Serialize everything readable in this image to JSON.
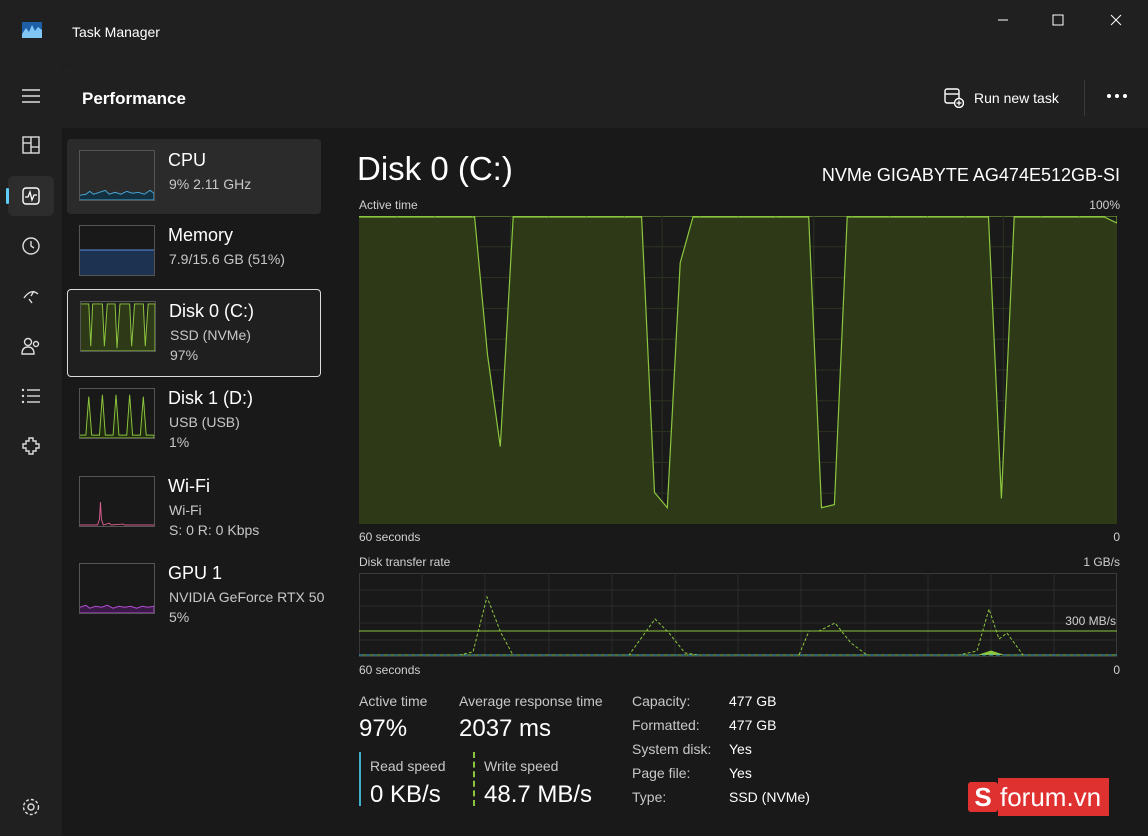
{
  "app": {
    "title": "Task Manager"
  },
  "header": {
    "title": "Performance",
    "run_task_label": "Run new task"
  },
  "nav": {
    "items": [
      "menu-icon",
      "processes-icon",
      "performance-icon",
      "app-history-icon",
      "startup-icon",
      "users-icon",
      "details-icon",
      "services-icon"
    ]
  },
  "sidebar": {
    "items": [
      {
        "name": "CPU",
        "line1": "9%  2.11 GHz",
        "line2": ""
      },
      {
        "name": "Memory",
        "line1": "7.9/15.6 GB (51%)",
        "line2": ""
      },
      {
        "name": "Disk 0 (C:)",
        "line1": "SSD (NVMe)",
        "line2": "97%"
      },
      {
        "name": "Disk 1 (D:)",
        "line1": "USB (USB)",
        "line2": "1%"
      },
      {
        "name": "Wi-Fi",
        "line1": "Wi-Fi",
        "line2": "S: 0 R: 0 Kbps"
      },
      {
        "name": "GPU 1",
        "line1": "NVIDIA GeForce RTX 50",
        "line2": "5%"
      }
    ]
  },
  "panel": {
    "title": "Disk 0 (C:)",
    "model": "NVMe GIGABYTE AG474E512GB-SI",
    "active_time_graph": {
      "label": "Active time",
      "max_label": "100%",
      "time_label": "60 seconds",
      "min_label": "0"
    },
    "transfer_graph": {
      "label": "Disk transfer rate",
      "max_label": "1 GB/s",
      "mid_label": "300 MB/s",
      "time_label": "60 seconds",
      "min_label": "0"
    }
  },
  "stats": {
    "active_time": {
      "label": "Active time",
      "value": "97%"
    },
    "avg_response": {
      "label": "Average response time",
      "value": "2037 ms"
    },
    "read_speed": {
      "label": "Read speed",
      "value": "0 KB/s"
    },
    "write_speed": {
      "label": "Write speed",
      "value": "48.7 MB/s"
    }
  },
  "info": [
    {
      "label": "Capacity:",
      "value": "477 GB"
    },
    {
      "label": "Formatted:",
      "value": "477 GB"
    },
    {
      "label": "System disk:",
      "value": "Yes"
    },
    {
      "label": "Page file:",
      "value": "Yes"
    },
    {
      "label": "Type:",
      "value": "SSD (NVMe)"
    }
  ],
  "watermark": {
    "letter": "S",
    "text": "forum.vn"
  },
  "colors": {
    "disk": "#8cc63e",
    "disk_fill": "#2e3a17",
    "cpu": "#4aa8d8",
    "memory": "#5b8fd8",
    "wifi": "#d85c8c",
    "gpu": "#b24fd0",
    "read": "#3fb0c8",
    "write": "#8cc63e"
  },
  "chart_data": {
    "type": "area",
    "title": "Active time",
    "x_label": "60 seconds",
    "ylim": [
      0,
      100
    ],
    "series": [
      {
        "values": [
          100,
          100,
          100,
          100,
          100,
          100,
          100,
          100,
          100,
          100,
          55,
          25,
          100,
          100,
          100,
          100,
          100,
          100,
          100,
          100,
          100,
          100,
          100,
          10,
          5,
          85,
          100,
          100,
          100,
          100,
          100,
          100,
          100,
          100,
          100,
          100,
          5,
          6,
          100,
          100,
          100,
          100,
          100,
          100,
          100,
          100,
          100,
          100,
          100,
          100,
          8,
          100,
          100,
          100,
          100,
          100,
          100,
          100,
          100,
          98
        ]
      }
    ]
  }
}
